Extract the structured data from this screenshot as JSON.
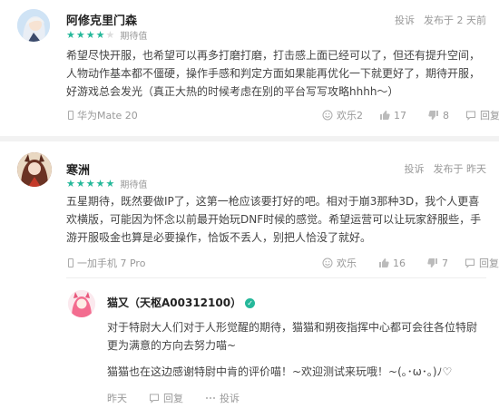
{
  "reviews": [
    {
      "username": "阿修克里门森",
      "rating": 4,
      "rating_tag": "期待值",
      "report_label": "投诉",
      "time": "发布于 2 天前",
      "text": "希望尽快开服，也希望可以再多打磨打磨，打击感上面已经可以了，但还有提升空间，人物动作基本都不僵硬，操作手感和判定方面如果能再优化一下就更好了，期待开服，好游戏总会发光（真正大热的时候考虑在别的平台写写攻略hhhh～）",
      "device": "华为Mate 20",
      "funny_label": "欢乐2",
      "likes": "17",
      "dislikes": "8",
      "reply_label": "回复"
    },
    {
      "username": "寒洲",
      "rating": 5,
      "rating_tag": "期待值",
      "report_label": "投诉",
      "time": "发布于 昨天",
      "text": "五星期待，既然要做IP了，这第一枪应该要打好的吧。相对于崩3那种3D，我个人更喜欢横版，可能因为怀念以前最开始玩DNF时候的感觉。希望运营可以让玩家舒服些，手游开服吸金也算是必要操作，恰饭不丢人，别把人恰没了就好。",
      "device": "一加手机 7 Pro",
      "funny_label": "欢乐",
      "likes": "16",
      "dislikes": "7",
      "reply_label": "回复"
    }
  ],
  "dev_reply": {
    "username": "猫又（天枢A00312100）",
    "badge": "✓",
    "line1": "对于特尉大人们对于人形觉醒的期待，猫猫和朔夜指挥中心都可会往各位特尉更为满意的方向去努力喵~",
    "line2": "猫猫也在这边感谢特尉中肯的评价喵！~欢迎测试来玩哦！~(｡･ω･｡)ﾉ♡",
    "time": "昨天",
    "reply_label": "回复",
    "report_label": "投诉"
  },
  "colors": {
    "accent": "#25b89a"
  }
}
